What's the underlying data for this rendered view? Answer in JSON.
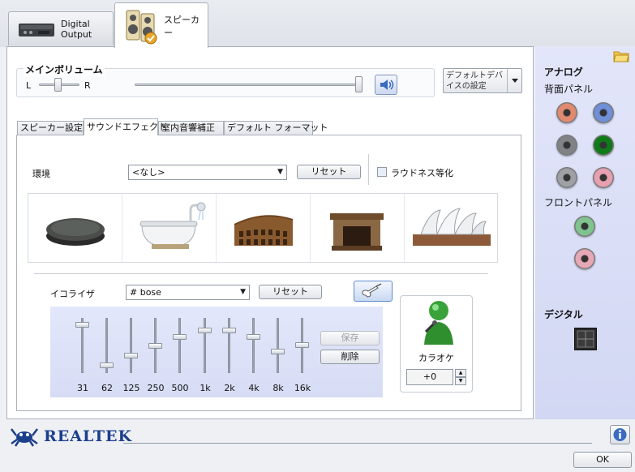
{
  "tabs": [
    {
      "label": "Digital Output",
      "active": false
    },
    {
      "label": "スピーカー",
      "active": true
    }
  ],
  "main_volume": {
    "title": "メインボリューム",
    "balance_left": "L",
    "balance_right": "R",
    "balance_level": 0.5,
    "volume_level": 1.0
  },
  "default_device_button": "デフォルトデバイスの設定",
  "subtabs": [
    {
      "label": "スピーカー設定",
      "active": false
    },
    {
      "label": "サウンドエフェクト",
      "active": true
    },
    {
      "label": "室内音響補正",
      "active": false
    },
    {
      "label": "デフォルト フォーマット",
      "active": false
    }
  ],
  "environment": {
    "label": "環境",
    "selected": "<なし>",
    "reset": "リセット",
    "loudness_label": "ラウドネス等化",
    "loudness_checked": false,
    "presets": [
      "stone",
      "bathtub",
      "colosseum",
      "fireplace",
      "opera-house"
    ]
  },
  "equalizer": {
    "label": "イコライザ",
    "selected": "# bose",
    "reset": "リセット",
    "save": "保存",
    "delete": "削除",
    "bands": [
      {
        "label": "31",
        "level": 0.92
      },
      {
        "label": "62",
        "level": 0.12
      },
      {
        "label": "125",
        "level": 0.3
      },
      {
        "label": "250",
        "level": 0.5
      },
      {
        "label": "500",
        "level": 0.68
      },
      {
        "label": "1k",
        "level": 0.8
      },
      {
        "label": "2k",
        "level": 0.8
      },
      {
        "label": "4k",
        "level": 0.68
      },
      {
        "label": "8k",
        "level": 0.38
      },
      {
        "label": "16k",
        "level": 0.52
      }
    ]
  },
  "karaoke": {
    "label": "カラオケ",
    "value": "+0"
  },
  "right_panel": {
    "analog_title": "アナログ",
    "rear_panel": "背面パネル",
    "front_panel": "フロントパネル",
    "digital_title": "デジタル",
    "jack_colors": {
      "rear": [
        "#e08a70",
        "#6f8fd8",
        "#808386",
        "#0f7a1a",
        "#9da0a4",
        "#e7a0b0"
      ],
      "front": [
        "#7fc48e",
        "#e7a8b6"
      ]
    }
  },
  "brand": "REALTEK",
  "ok_button": "OK",
  "colors": {
    "accent_blue": "#3b6bbf",
    "realtek_blue": "#1c3f8c"
  }
}
